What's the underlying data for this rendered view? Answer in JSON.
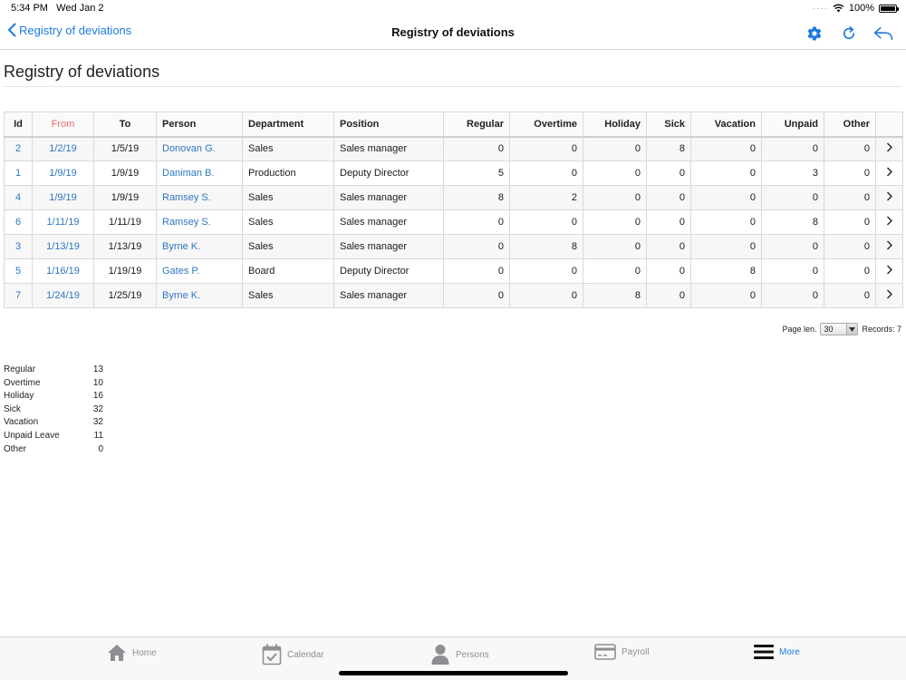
{
  "status_bar": {
    "time": "5:34 PM",
    "date": "Wed Jan 2",
    "battery": "100%"
  },
  "nav": {
    "back_label": "Registry of deviations",
    "title": "Registry of deviations",
    "icons": [
      "gear-icon",
      "refresh-icon",
      "reply-icon"
    ]
  },
  "page": {
    "title": "Registry of deviations"
  },
  "table": {
    "headers": {
      "id": "Id",
      "from": "From",
      "to": "To",
      "person": "Person",
      "department": "Department",
      "position": "Position",
      "regular": "Regular",
      "overtime": "Overtime",
      "holiday": "Holiday",
      "sick": "Sick",
      "vacation": "Vacation",
      "unpaid": "Unpaid",
      "other": "Other"
    },
    "rows": [
      {
        "id": "2",
        "from": "1/2/19",
        "to": "1/5/19",
        "person": "Donovan G.",
        "department": "Sales",
        "position": "Sales manager",
        "regular": "0",
        "overtime": "0",
        "holiday": "0",
        "sick": "8",
        "vacation": "0",
        "unpaid": "0",
        "other": "0"
      },
      {
        "id": "1",
        "from": "1/9/19",
        "to": "1/9/19",
        "person": "Daniman B.",
        "department": "Production",
        "position": "Deputy Director",
        "regular": "5",
        "overtime": "0",
        "holiday": "0",
        "sick": "0",
        "vacation": "0",
        "unpaid": "3",
        "other": "0"
      },
      {
        "id": "4",
        "from": "1/9/19",
        "to": "1/9/19",
        "person": "Ramsey S.",
        "department": "Sales",
        "position": "Sales manager",
        "regular": "8",
        "overtime": "2",
        "holiday": "0",
        "sick": "0",
        "vacation": "0",
        "unpaid": "0",
        "other": "0"
      },
      {
        "id": "6",
        "from": "1/11/19",
        "to": "1/11/19",
        "person": "Ramsey S.",
        "department": "Sales",
        "position": "Sales manager",
        "regular": "0",
        "overtime": "0",
        "holiday": "0",
        "sick": "0",
        "vacation": "0",
        "unpaid": "8",
        "other": "0"
      },
      {
        "id": "3",
        "from": "1/13/19",
        "to": "1/13/19",
        "person": "Byrne K.",
        "department": "Sales",
        "position": "Sales manager",
        "regular": "0",
        "overtime": "8",
        "holiday": "0",
        "sick": "0",
        "vacation": "0",
        "unpaid": "0",
        "other": "0"
      },
      {
        "id": "5",
        "from": "1/16/19",
        "to": "1/19/19",
        "person": "Gates P.",
        "department": "Board",
        "position": "Deputy Director",
        "regular": "0",
        "overtime": "0",
        "holiday": "0",
        "sick": "0",
        "vacation": "8",
        "unpaid": "0",
        "other": "0"
      },
      {
        "id": "7",
        "from": "1/24/19",
        "to": "1/25/19",
        "person": "Byrne K.",
        "department": "Sales",
        "position": "Sales manager",
        "regular": "0",
        "overtime": "0",
        "holiday": "8",
        "sick": "0",
        "vacation": "0",
        "unpaid": "0",
        "other": "0"
      }
    ]
  },
  "pager": {
    "page_len_label": "Page len.",
    "page_len_value": "30",
    "records_label": "Records: 7"
  },
  "summary": [
    {
      "label": "Regular",
      "value": "13"
    },
    {
      "label": "Overtime",
      "value": "10"
    },
    {
      "label": "Holiday",
      "value": "16"
    },
    {
      "label": "Sick",
      "value": "32"
    },
    {
      "label": "Vacation",
      "value": "32"
    },
    {
      "label": "Unpaid Leave",
      "value": "11"
    },
    {
      "label": "Other",
      "value": "0"
    }
  ],
  "tabs": [
    {
      "key": "home",
      "label": "Home",
      "icon": "home-icon"
    },
    {
      "key": "calendar",
      "label": "Calendar",
      "icon": "calendar-icon"
    },
    {
      "key": "persons",
      "label": "Persons",
      "icon": "person-icon"
    },
    {
      "key": "payroll",
      "label": "Payroll",
      "icon": "card-icon"
    },
    {
      "key": "more",
      "label": "More",
      "icon": "menu-icon"
    }
  ],
  "colors": {
    "accent": "#1e7be0",
    "link": "#2e75c2",
    "sorted_header": "#e46a6a",
    "tab_inactive": "#8e8e93"
  }
}
